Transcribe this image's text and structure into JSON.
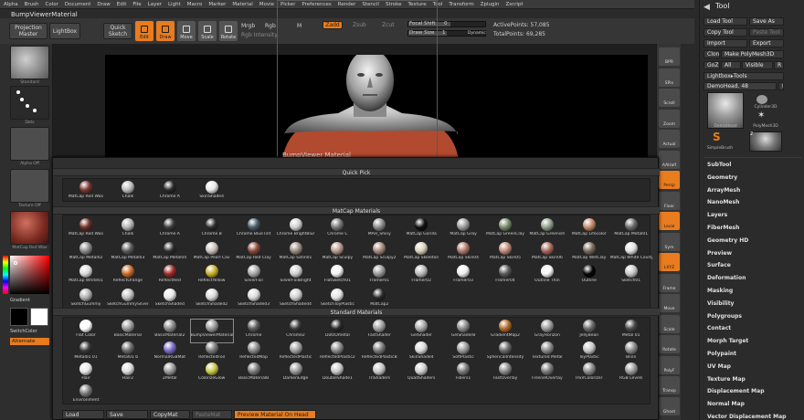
{
  "menu": [
    "Alpha",
    "Brush",
    "Color",
    "Document",
    "Draw",
    "Edit",
    "File",
    "Layer",
    "Light",
    "Macro",
    "Marker",
    "Material",
    "Movie",
    "Picker",
    "Preferences",
    "Render",
    "Stencil",
    "Stroke",
    "Texture",
    "Tool",
    "Transform",
    "Zplugin",
    "Zscript"
  ],
  "document_title": "BumpViewerMaterial",
  "shelf": {
    "projection_master": "Projection Master",
    "lightbox": "LightBox",
    "quick_sketch": "Quick Sketch",
    "edit": "Edit",
    "draw": "Draw",
    "move": "Move",
    "scale": "Scale",
    "rotate": "Rotate",
    "mrgb": "Mrgb",
    "rgb": "Rgb",
    "m": "M",
    "rgb_intensity": "Rgb Intensity",
    "zadd": "Zadd",
    "zsub": "Zsub",
    "zcut": "Zcut",
    "focal_shift": "Focal Shift",
    "focal_value": "0",
    "draw_size": "Draw Size",
    "draw_value": "1",
    "dynamic": "Dynamic",
    "active_points": "ActivePoints: 57,085",
    "total_points": "TotalPoints: 69,285"
  },
  "left": {
    "standard": "Standard",
    "dots": "Dots",
    "alpha_off": "Alpha Off",
    "texture_off": "Texture Off",
    "matcap_red_wax": "MatCap Red Wax",
    "gradient": "Gradient",
    "switch_color": "SwitchColor",
    "alternate": "Alternate"
  },
  "canvas_label": "BumpViewer Material",
  "right_shelf": [
    "BPR",
    "SPix",
    "Scroll",
    "Zoom",
    "Actual",
    "AAHalf",
    "Persp",
    "Floor",
    "Local",
    "Sym",
    "LXYZ",
    "Frame",
    "Move",
    "Scale",
    "Rotate",
    "PolyF",
    "Transp",
    "Ghost"
  ],
  "right_shelf_active": [
    "Persp",
    "Local",
    "LXYZ"
  ],
  "tool": {
    "header": "Tool",
    "load_tool": "Load Tool",
    "save_as": "Save As",
    "copy_tool": "Copy Tool",
    "paste_tool": "Paste Tool",
    "import": "Import",
    "export": "Export",
    "clone": "Clone",
    "make_polymesh": "Make PolyMesh3D",
    "goz": "GoZ",
    "all": "All",
    "visible": "Visible",
    "r": "R",
    "lightbox_tools": "Lightbox▸Tools",
    "demohead_label": "DemoHead. 48",
    "demohead": "DemoHead",
    "cylinder3d": "Cylinder3D",
    "polymesh3d": "PolyMesh3D",
    "simplebrush": "SimpleBrush",
    "count2": "2",
    "sections": [
      "SubTool",
      "Geometry",
      "ArrayMesh",
      "NanoMesh",
      "Layers",
      "FiberMesh",
      "Geometry HD",
      "Preview",
      "Surface",
      "Deformation",
      "Masking",
      "Visibility",
      "Polygroups",
      "Contact",
      "Morph Target",
      "Polypaint",
      "UV Map",
      "Texture Map",
      "Displacement Map",
      "Normal Map",
      "Vector Displacement Map"
    ]
  },
  "popup": {
    "quick_pick_title": "Quick Pick",
    "quick_pick": [
      {
        "name": "MatCap Red Wax",
        "color": "#7a3a30"
      },
      {
        "name": "Chalk",
        "color": "#bdbdbd"
      },
      {
        "name": "Chrome A",
        "color": "#2a2a2a"
      },
      {
        "name": "SkinShade4",
        "color": "#e8e8e8"
      }
    ],
    "matcap_title": "MatCap Materials",
    "matcap": [
      {
        "name": "MatCap Red Wax",
        "color": "#6e3028"
      },
      {
        "name": "Chalk",
        "color": "#b5b5b5"
      },
      {
        "name": "Chrome A",
        "color": "#3a3a3a"
      },
      {
        "name": "Chrome B",
        "color": "#2c2c2c"
      },
      {
        "name": "Chrome BlueTint",
        "color": "#4a5a6a"
      },
      {
        "name": "Chrome BrightBlur",
        "color": "#d0d0d0"
      },
      {
        "name": "Chrome C",
        "color": "#777777"
      },
      {
        "name": "MAH_Shiny",
        "color": "#8a8a8a"
      },
      {
        "name": "MatCap Gorilla",
        "color": "#111111"
      },
      {
        "name": "MatCap Gray",
        "color": "#9a9a9a"
      },
      {
        "name": "MatCap GreenClay",
        "color": "#7a8a6a"
      },
      {
        "name": "MatCap Greenish",
        "color": "#8fa08a"
      },
      {
        "name": "MatCap Lifecolor",
        "color": "#c48a6a"
      },
      {
        "name": "MatCap Metal01",
        "color": "#6a6a6a"
      },
      {
        "name": "MatCap Metal02",
        "color": "#8a8a8a"
      },
      {
        "name": "MatCap Metal03",
        "color": "#5a5a5a"
      },
      {
        "name": "MatCap Metal04",
        "color": "#2f2f2f"
      },
      {
        "name": "MatCap Pearl Cav",
        "color": "#c9c0b8"
      },
      {
        "name": "MatCap Red Clay",
        "color": "#8a4a3a"
      },
      {
        "name": "MatCap Satin01",
        "color": "#9a8c80"
      },
      {
        "name": "MatCap Sculpy",
        "color": "#b89a8a"
      },
      {
        "name": "MatCap Sculpy2",
        "color": "#a88a7a"
      },
      {
        "name": "MatCap Skeleton",
        "color": "#d8d0b8"
      },
      {
        "name": "MatCap Skin04",
        "color": "#b07a6a"
      },
      {
        "name": "MatCap Skin05",
        "color": "#c08a7a"
      },
      {
        "name": "MatCap Skin06",
        "color": "#a86a5a"
      },
      {
        "name": "MatCap WetClay",
        "color": "#7a6a5a"
      },
      {
        "name": "MatCap White Cavity",
        "color": "#e0e0e0"
      },
      {
        "name": "MatCap White01",
        "color": "#dcdcdc"
      },
      {
        "name": "ReflectOrange",
        "color": "#c86a2a"
      },
      {
        "name": "ReflectRed",
        "color": "#a02a2a"
      },
      {
        "name": "ReflectYellow",
        "color": "#c8b02a"
      },
      {
        "name": "SilverFoil",
        "color": "#a8a8a8"
      },
      {
        "name": "SilverFoilBright",
        "color": "#d0d0d0"
      },
      {
        "name": "FlatSketch01",
        "color": "#f4f4f4"
      },
      {
        "name": "Framer01",
        "color": "#9a9a9a"
      },
      {
        "name": "Framer02",
        "color": "#bababa"
      },
      {
        "name": "Framer03",
        "color": "#f0f0f0"
      },
      {
        "name": "Framer04",
        "color": "#5a5a5a"
      },
      {
        "name": "Outline Thin",
        "color": "#f8f8f8"
      },
      {
        "name": "Outline",
        "color": "#050505"
      },
      {
        "name": "Sketch01",
        "color": "#c8c8c8"
      },
      {
        "name": "SketchGummy",
        "color": "#b0b0b0"
      },
      {
        "name": "SketchGummySilver",
        "color": "#c0c0c0"
      },
      {
        "name": "SketchShaded",
        "color": "#e8e8e8"
      },
      {
        "name": "SketchShaded2",
        "color": "#d8d8d8"
      },
      {
        "name": "SketchShaded3",
        "color": "#dadada"
      },
      {
        "name": "SketchShaded4",
        "color": "#cfcfcf"
      },
      {
        "name": "SketchToyPlastic",
        "color": "#e4e4e4"
      },
      {
        "name": "MatCap2",
        "color": "#2a2a2a"
      }
    ],
    "standard_title": "Standard Materials",
    "standard": [
      {
        "name": "Flat Color",
        "color": "#ffffff"
      },
      {
        "name": "BasicMaterial",
        "color": "#9a9a9a"
      },
      {
        "name": "BasicMaterial2",
        "color": "#8a8a8a"
      },
      {
        "name": "BumpViewerMaterial",
        "color": "#9a9a9a"
      },
      {
        "name": "Chrome",
        "color": "#5a5a5a"
      },
      {
        "name": "Chrome2",
        "color": "#3a3a3a"
      },
      {
        "name": "DotsOmetal",
        "color": "#2a2a2a"
      },
      {
        "name": "FastShader",
        "color": "#a0a0a0"
      },
      {
        "name": "GelShader",
        "color": "#a8a8a8"
      },
      {
        "name": "GelShaderB",
        "color": "#8a8a8a"
      },
      {
        "name": "GradientMap2",
        "color": "#b06a2a"
      },
      {
        "name": "GrayHorizon",
        "color": "#9a9a9a"
      },
      {
        "name": "JellyBean",
        "color": "#6a6a6a"
      },
      {
        "name": "Metal 01",
        "color": "#4a4a4a"
      },
      {
        "name": "Metal01 01",
        "color": "#3a3a3a"
      },
      {
        "name": "Metal01 b",
        "color": "#6a6a6a"
      },
      {
        "name": "NormalRGBMat",
        "color": "#7a6ac8"
      },
      {
        "name": "ReflectedFoil",
        "color": "#7a7a7a"
      },
      {
        "name": "ReflectedMap",
        "color": "#8a8a8a"
      },
      {
        "name": "ReflectedPlastic",
        "color": "#a0a0a0"
      },
      {
        "name": "ReflectedPlastic2",
        "color": "#8a8a8a"
      },
      {
        "name": "ReflectedPlasticB",
        "color": "#7a7a7a"
      },
      {
        "name": "SkinShade4",
        "color": "#dadada"
      },
      {
        "name": "SoftPlastic",
        "color": "#9a9a9a"
      },
      {
        "name": "SphericalIntensity",
        "color": "#6a6a6a"
      },
      {
        "name": "Textured Metal",
        "color": "#8a8a8a"
      },
      {
        "name": "ToyPlastic",
        "color": "#c8c8c8"
      },
      {
        "name": "Blinn",
        "color": "#8a8a8a"
      },
      {
        "name": "Hair",
        "color": "#e8e8e8"
      },
      {
        "name": "Hair2",
        "color": "#dcdcdc"
      },
      {
        "name": "ZMetal",
        "color": "#9a9a9a"
      },
      {
        "name": "ColorizeGlow",
        "color": "#c8c84a"
      },
      {
        "name": "BasicMaterialB",
        "color": "#7a7a7a"
      },
      {
        "name": "DarkenEdge",
        "color": "#9a9a9a"
      },
      {
        "name": "DoubleShade1",
        "color": "#c8c8c8"
      },
      {
        "name": "TriShaders",
        "color": "#c8c8c8"
      },
      {
        "name": "QuadShaders",
        "color": "#cfcfcf"
      },
      {
        "name": "Fibers1",
        "color": "#7a7a7a"
      },
      {
        "name": "FastOverlay",
        "color": "#8a8a8a"
      },
      {
        "name": "FresnelOverlay",
        "color": "#7a7a7a"
      },
      {
        "name": "HSVColorizer",
        "color": "#8a8a8a"
      },
      {
        "name": "RGB Levels",
        "color": "#9a9a9a"
      },
      {
        "name": "Environment",
        "color": "#7a7a7a"
      }
    ],
    "load": "Load",
    "save": "Save",
    "copy_mat": "CopyMat",
    "paste_mat": "PasteMat",
    "preview_on_head": "Preview Material On Head"
  },
  "colors": {
    "accent": "#e87c1e",
    "selected_material_outline": "#8a8a8a"
  }
}
